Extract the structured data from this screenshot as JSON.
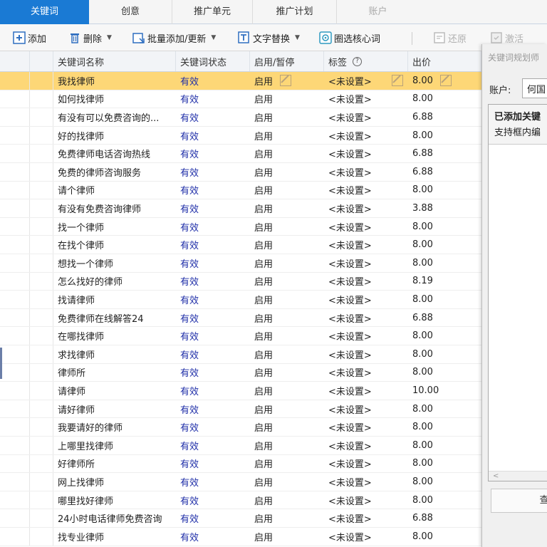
{
  "tabs": [
    {
      "label": "关键词",
      "active": true
    },
    {
      "label": "创意",
      "active": false
    },
    {
      "label": "推广单元",
      "active": false
    },
    {
      "label": "推广计划",
      "active": false
    },
    {
      "label": "账户",
      "active": false,
      "disabled": true
    }
  ],
  "toolbar": {
    "add": "添加",
    "delete": "删除",
    "batch": "批量添加/更新",
    "replace": "文字替换",
    "core": "圈选核心词",
    "restore": "还原",
    "activate": "激活"
  },
  "columns": [
    "关键词名称",
    "关键词状态",
    "启用/暂停",
    "标签",
    "出价"
  ],
  "rows": [
    {
      "name": "我找律师",
      "status": "有效",
      "enabled": "启用",
      "tag": "<未设置>",
      "bid": "8.00",
      "selected": true
    },
    {
      "name": "如何找律师",
      "status": "有效",
      "enabled": "启用",
      "tag": "<未设置>",
      "bid": "8.00"
    },
    {
      "name": "有没有可以免费咨询的...",
      "status": "有效",
      "enabled": "启用",
      "tag": "<未设置>",
      "bid": "6.88"
    },
    {
      "name": "好的找律师",
      "status": "有效",
      "enabled": "启用",
      "tag": "<未设置>",
      "bid": "8.00"
    },
    {
      "name": "免费律师电话咨询热线",
      "status": "有效",
      "enabled": "启用",
      "tag": "<未设置>",
      "bid": "6.88"
    },
    {
      "name": "免费的律师咨询服务",
      "status": "有效",
      "enabled": "启用",
      "tag": "<未设置>",
      "bid": "6.88"
    },
    {
      "name": "请个律师",
      "status": "有效",
      "enabled": "启用",
      "tag": "<未设置>",
      "bid": "8.00"
    },
    {
      "name": "有没有免费咨询律师",
      "status": "有效",
      "enabled": "启用",
      "tag": "<未设置>",
      "bid": "3.88"
    },
    {
      "name": "找一个律师",
      "status": "有效",
      "enabled": "启用",
      "tag": "<未设置>",
      "bid": "8.00"
    },
    {
      "name": "在找个律师",
      "status": "有效",
      "enabled": "启用",
      "tag": "<未设置>",
      "bid": "8.00"
    },
    {
      "name": "想找一个律师",
      "status": "有效",
      "enabled": "启用",
      "tag": "<未设置>",
      "bid": "8.00"
    },
    {
      "name": "怎么找好的律师",
      "status": "有效",
      "enabled": "启用",
      "tag": "<未设置>",
      "bid": "8.19"
    },
    {
      "name": "找请律师",
      "status": "有效",
      "enabled": "启用",
      "tag": "<未设置>",
      "bid": "8.00"
    },
    {
      "name": "免费律师在线解答24",
      "status": "有效",
      "enabled": "启用",
      "tag": "<未设置>",
      "bid": "6.88"
    },
    {
      "name": "在哪找律师",
      "status": "有效",
      "enabled": "启用",
      "tag": "<未设置>",
      "bid": "8.00"
    },
    {
      "name": "求找律师",
      "status": "有效",
      "enabled": "启用",
      "tag": "<未设置>",
      "bid": "8.00"
    },
    {
      "name": "律师所",
      "status": "有效",
      "enabled": "启用",
      "tag": "<未设置>",
      "bid": "8.00"
    },
    {
      "name": "请律师",
      "status": "有效",
      "enabled": "启用",
      "tag": "<未设置>",
      "bid": "10.00"
    },
    {
      "name": "请好律师",
      "status": "有效",
      "enabled": "启用",
      "tag": "<未设置>",
      "bid": "8.00"
    },
    {
      "name": "我要请好的律师",
      "status": "有效",
      "enabled": "启用",
      "tag": "<未设置>",
      "bid": "8.00"
    },
    {
      "name": "上哪里找律师",
      "status": "有效",
      "enabled": "启用",
      "tag": "<未设置>",
      "bid": "8.00"
    },
    {
      "name": "好律师所",
      "status": "有效",
      "enabled": "启用",
      "tag": "<未设置>",
      "bid": "8.00"
    },
    {
      "name": "网上找律师",
      "status": "有效",
      "enabled": "启用",
      "tag": "<未设置>",
      "bid": "8.00"
    },
    {
      "name": "哪里找好律师",
      "status": "有效",
      "enabled": "启用",
      "tag": "<未设置>",
      "bid": "8.00"
    },
    {
      "name": "24小时电话律师免费咨询",
      "status": "有效",
      "enabled": "启用",
      "tag": "<未设置>",
      "bid": "6.88"
    },
    {
      "name": "找专业律师",
      "status": "有效",
      "enabled": "启用",
      "tag": "<未设置>",
      "bid": "8.00"
    }
  ],
  "panel": {
    "title": "关键词规划师",
    "account_label": "账户:",
    "account_value": "何国",
    "box_title": "已添加关键",
    "box_subtitle": "支持框内编",
    "scroll_left": "<",
    "button": "查"
  },
  "colors": {
    "accent": "#1a7ad4",
    "selected_row": "#fdd777",
    "status_text": "#1f2ea8"
  }
}
